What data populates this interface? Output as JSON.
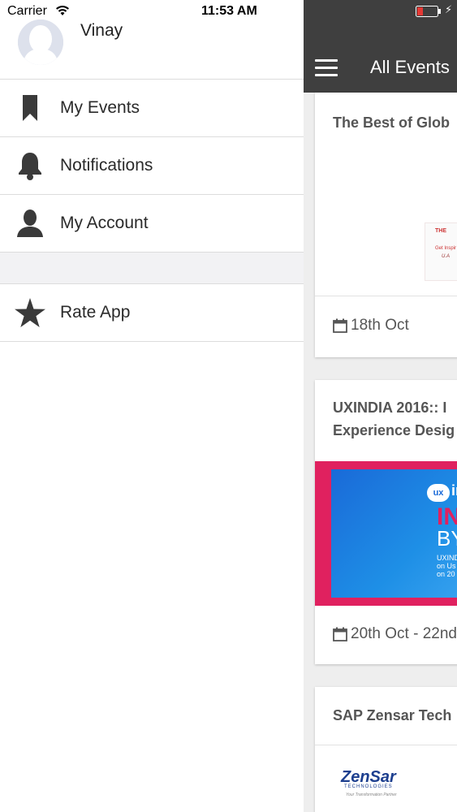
{
  "status_bar": {
    "carrier": "Carrier",
    "time": "11:53 AM"
  },
  "profile": {
    "name": "Vinay"
  },
  "drawer_menu": {
    "items": [
      {
        "label": "My Events",
        "icon": "bookmark-icon"
      },
      {
        "label": "Notifications",
        "icon": "bell-icon"
      },
      {
        "label": "My Account",
        "icon": "person-icon"
      },
      {
        "label": "Rate App",
        "icon": "star-icon"
      }
    ]
  },
  "app_bar": {
    "title": "All Events"
  },
  "events": [
    {
      "title_lines": [
        "The Best of Glob"
      ],
      "date": "18th Oct"
    },
    {
      "title_lines": [
        "UXINDIA 2016:: I",
        "Experience Desig"
      ],
      "date": "20th Oct - 22nd"
    },
    {
      "title_lines": [
        "SAP Zensar Tech"
      ],
      "date": ""
    }
  ],
  "event_images": {
    "global_banner": {
      "line1": "THE",
      "line2": "Get Inspir",
      "line3": "U.A"
    },
    "uxindia_banner": {
      "badge": "ux",
      "brand": "in",
      "headline1": "IN",
      "headline2": "BY",
      "caption": "UXIND\non Us\non 20"
    },
    "zensar_logo": {
      "brand": "ZenSar",
      "sub": "TECHNOLOGIES",
      "tagline": "Your Transformation Partner"
    }
  },
  "colors": {
    "app_bar_bg": "#3f3f3f",
    "uxindia_pink": "#e0215f",
    "uxindia_blue": "#1a6ad8",
    "zensar_blue": "#1d3f8f",
    "battery_low": "#e53935"
  }
}
